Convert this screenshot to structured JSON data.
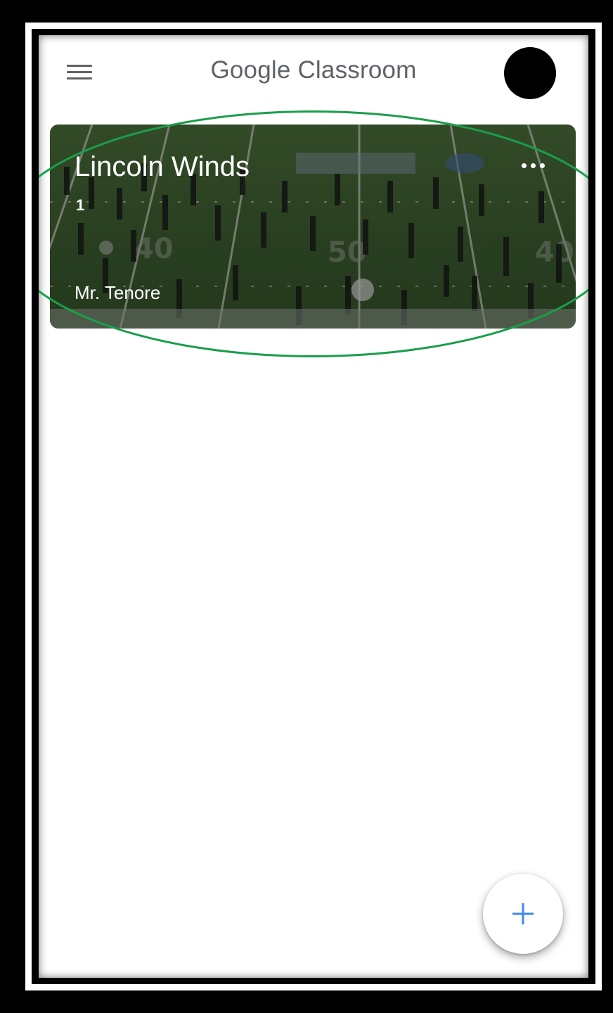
{
  "app_bar": {
    "title": "Google Classroom",
    "menu_icon": "hamburger-menu-icon",
    "avatar_icon": "account-avatar"
  },
  "class_card": {
    "title": "Lincoln Winds",
    "section": "1",
    "teacher": "Mr. Tenore",
    "overflow_icon": "more-horizontal-icon",
    "background_image": "marching-band-on-football-field",
    "highlight_color": "#1a9e4a"
  },
  "fab": {
    "icon": "plus-icon",
    "color": "#4285f4"
  },
  "colors": {
    "title_gray": "#5f6368",
    "screen_bg": "#ffffff",
    "frame": "#000000"
  }
}
